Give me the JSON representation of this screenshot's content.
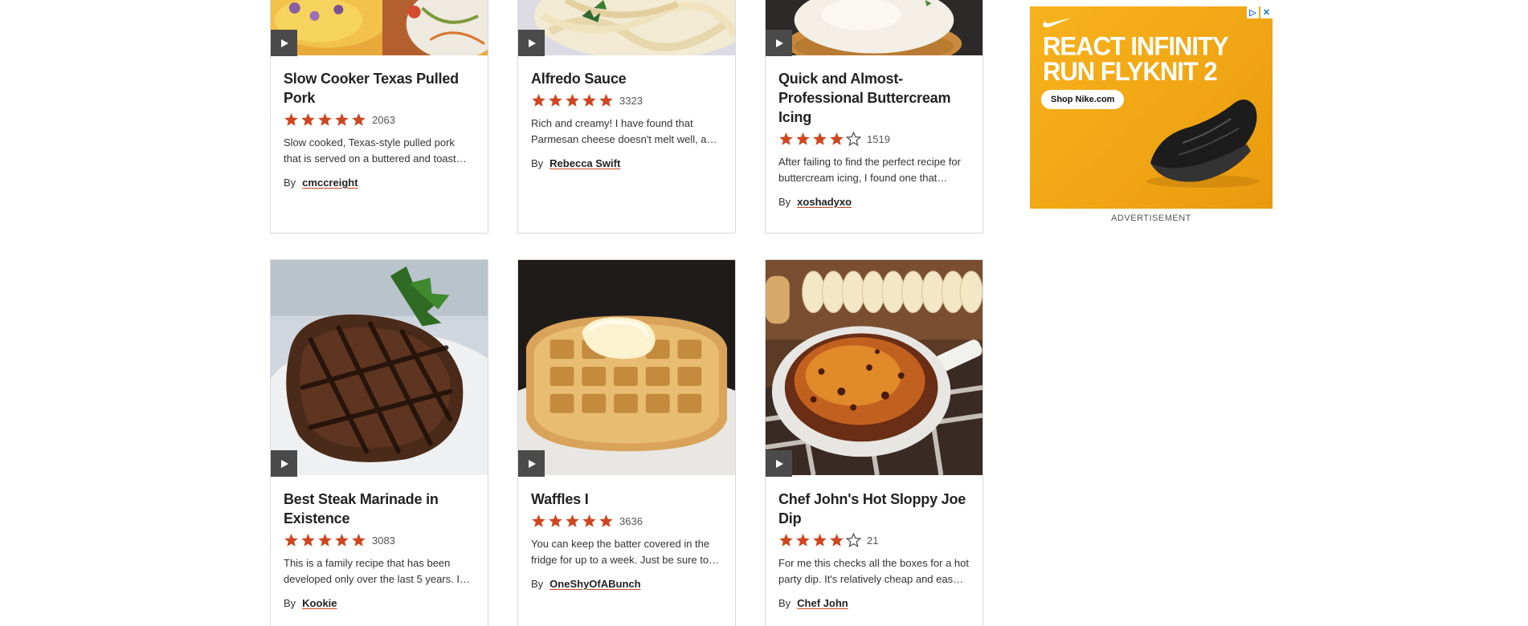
{
  "recipes": [
    {
      "title": "Slow Cooker Texas Pulled Pork",
      "rating": 5,
      "rating_count": "2063",
      "description": "Slow cooked, Texas-style pulled pork that is served on a buttered and toast…",
      "by_label": "By",
      "author": "cmccreight",
      "image": "corn-coleslaw-photo"
    },
    {
      "title": "Alfredo Sauce",
      "rating": 5,
      "rating_count": "3323",
      "description": "Rich and creamy! I have found that Parmesan cheese doesn't melt well, a…",
      "by_label": "By",
      "author": "Rebecca Swift",
      "image": "fettuccine-alfredo-photo"
    },
    {
      "title": "Quick and Almost-Professional Buttercream Icing",
      "rating": 4,
      "rating_count": "1519",
      "description": "After failing to find the perfect recipe for buttercream icing, I found one that…",
      "by_label": "By",
      "author": "xoshadyxo",
      "image": "frosted-cupcake-photo"
    },
    {
      "title": "Best Steak Marinade in Existence",
      "rating": 5,
      "rating_count": "3083",
      "description": "This is a family recipe that has been developed only over the last 5 years. I…",
      "by_label": "By",
      "author": "Kookie",
      "image": "grilled-steak-photo"
    },
    {
      "title": "Waffles I",
      "rating": 5,
      "rating_count": "3636",
      "description": "You can keep the batter covered in the fridge for up to a week. Just be sure to…",
      "by_label": "By",
      "author": "OneShyOfABunch",
      "image": "waffle-with-butter-photo"
    },
    {
      "title": "Chef John's Hot Sloppy Joe Dip",
      "rating": 4,
      "rating_count": "21",
      "description": "For me this checks all the boxes for a hot party dip. It's relatively cheap and eas…",
      "by_label": "By",
      "author": "Chef John",
      "image": "sloppy-joe-dip-photo"
    }
  ],
  "ad": {
    "headline_line1": "REACT INFINITY",
    "headline_line2": "RUN FLYKNIT 2",
    "cta": "Shop Nike.com",
    "label": "ADVERTISEMENT",
    "brand_icon": "nike-swoosh-icon",
    "choices_icons": [
      "ad-choices-icon",
      "close-icon"
    ],
    "background": "#f7b21c"
  },
  "colors": {
    "star": "#ce4620",
    "star_empty": "#555555",
    "play_button": "#4a4a4a",
    "author_underline": "#ce4620"
  }
}
